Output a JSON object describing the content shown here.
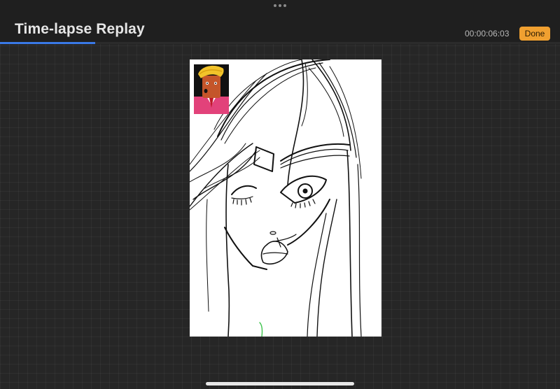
{
  "header": {
    "title": "Time-lapse Replay",
    "timer": "00:00:06:03",
    "done_label": "Done"
  },
  "playback": {
    "progress_fraction": 0.17
  },
  "colors": {
    "accent": "#3a79e6",
    "done_button": "#f0a030",
    "background": "#262626"
  },
  "icons": {
    "more": "more-dots-icon"
  }
}
